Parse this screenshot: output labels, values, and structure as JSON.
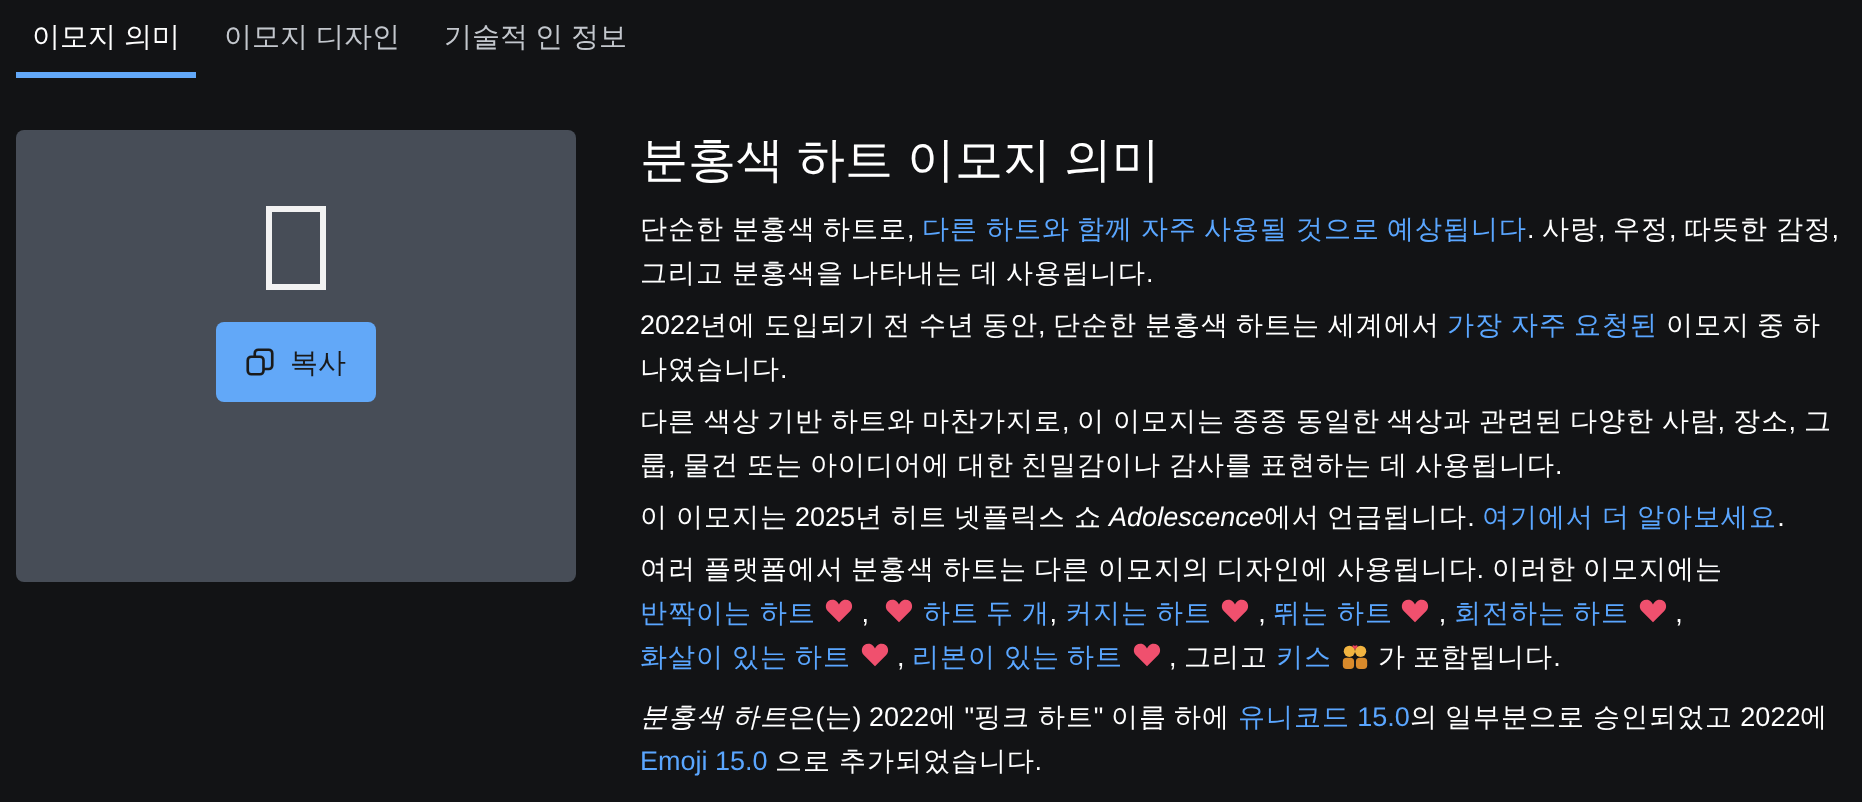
{
  "tabs": [
    {
      "label": "이모지 의미",
      "selected": true
    },
    {
      "label": "이모지 디자인",
      "selected": false
    },
    {
      "label": "기술적 인 정보",
      "selected": false
    }
  ],
  "copy_button": {
    "label": "복사"
  },
  "title": "분홍색 하트 이모지 의미",
  "paragraphs": [
    [
      {
        "kind": "text",
        "text": "단순한 분홍색 하트로, "
      },
      {
        "kind": "link",
        "text": "다른 하트와 함께 자주 사용될 것으로 예상됩니다"
      },
      {
        "kind": "text",
        "text": ". 사랑, 우정, 따뜻한 감정, 그리고 분홍색을 나타내는 데 사용됩니다."
      }
    ],
    [
      {
        "kind": "text",
        "text": "2022년에 도입되기 전 수년 동안, 단순한 분홍색 하트는 세계에서 "
      },
      {
        "kind": "link",
        "text": "가장 자주 요청된"
      },
      {
        "kind": "text",
        "text": " 이모지 중 하나였습니다."
      }
    ],
    [
      {
        "kind": "text",
        "text": "다른 색상 기반 하트와 마찬가지로, 이 이모지는 종종 동일한 색상과 관련된 다양한 사람, 장소, 그룹, 물건 또는 아이디어에 대한 친밀감이나 감사를 표현하는 데 사용됩니다."
      }
    ],
    [
      {
        "kind": "text",
        "text": "이 이모지는 2025년 히트 넷플릭스 쇼 "
      },
      {
        "kind": "italic",
        "text": "Adolescence"
      },
      {
        "kind": "text",
        "text": "에서 언급됩니다. "
      },
      {
        "kind": "link",
        "text": "여기에서 더 알아보세요"
      },
      {
        "kind": "text",
        "text": "."
      }
    ],
    [
      {
        "kind": "text",
        "text": "여러 플랫폼에서 분홍색 하트는 다른 이모지의 디자인에 사용됩니다. 이러한 이모지에는 "
      },
      {
        "kind": "link",
        "text": "반짝이는 하트"
      },
      {
        "kind": "heart"
      },
      {
        "kind": "text",
        "text": ", "
      },
      {
        "kind": "heart"
      },
      {
        "kind": "link",
        "text": "하트 두 개"
      },
      {
        "kind": "text",
        "text": ", "
      },
      {
        "kind": "link",
        "text": "커지는 하트"
      },
      {
        "kind": "heart"
      },
      {
        "kind": "text",
        "text": ", "
      },
      {
        "kind": "link",
        "text": "뛰는 하트"
      },
      {
        "kind": "heart"
      },
      {
        "kind": "text",
        "text": ", "
      },
      {
        "kind": "link",
        "text": "회전하는 하트"
      },
      {
        "kind": "heart"
      },
      {
        "kind": "text",
        "text": ", "
      },
      {
        "kind": "link",
        "text": "화살이 있는 하트"
      },
      {
        "kind": "heart"
      },
      {
        "kind": "text",
        "text": ", "
      },
      {
        "kind": "link",
        "text": "리본이 있는 하트"
      },
      {
        "kind": "heart"
      },
      {
        "kind": "text",
        "text": ", 그리고 "
      },
      {
        "kind": "link",
        "text": "키스"
      },
      {
        "kind": "kiss"
      },
      {
        "kind": "text",
        "text": "가 포함됩니다."
      }
    ],
    [
      {
        "kind": "italic",
        "text": "분홍색 하트"
      },
      {
        "kind": "text",
        "text": "은(는) 2022에 \"핑크 하트\" 이름 하에 "
      },
      {
        "kind": "link",
        "text": "유니코드 15.0"
      },
      {
        "kind": "text",
        "text": "의 일부분으로 승인되었고 2022에 "
      },
      {
        "kind": "link",
        "text": "Emoji 15.0"
      },
      {
        "kind": "text",
        "text": " 으로 추가되었습니다."
      }
    ]
  ]
}
